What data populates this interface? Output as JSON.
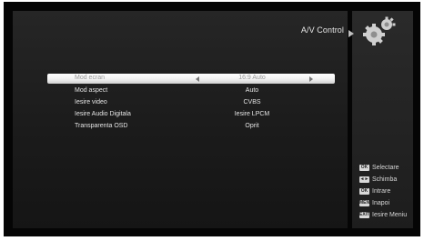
{
  "header": {
    "title": "A/V Control",
    "icon": "gears-icon"
  },
  "menu": {
    "rows": [
      {
        "label": "Mod ecran",
        "value": "16:9 Auto",
        "selected": true
      },
      {
        "label": "Mod aspect",
        "value": "Auto",
        "selected": false
      },
      {
        "label": "Iesire video",
        "value": "CVBS",
        "selected": false
      },
      {
        "label": "Iesire Audio Digitala",
        "value": "Iesire LPCM",
        "selected": false
      },
      {
        "label": "Transparenta OSD",
        "value": "Oprit",
        "selected": false
      }
    ]
  },
  "legend": {
    "items": [
      {
        "key": "OK",
        "label": "Selectare",
        "icon": "ok-key-icon"
      },
      {
        "key": "◄►",
        "label": "Schimba",
        "icon": "left-right-key-icon"
      },
      {
        "key": "OK",
        "label": "Intrare",
        "icon": "ok-key-icon"
      },
      {
        "key": "MENU",
        "label": "Inapoi",
        "icon": "menu-key-icon"
      },
      {
        "key": "EXIT",
        "label": "Iesire Meniu",
        "icon": "exit-key-icon"
      }
    ]
  },
  "colors": {
    "background": "#050505",
    "panel": "#1f1f1f",
    "highlight": "#f2f2f2",
    "text": "#e4e4e4"
  }
}
